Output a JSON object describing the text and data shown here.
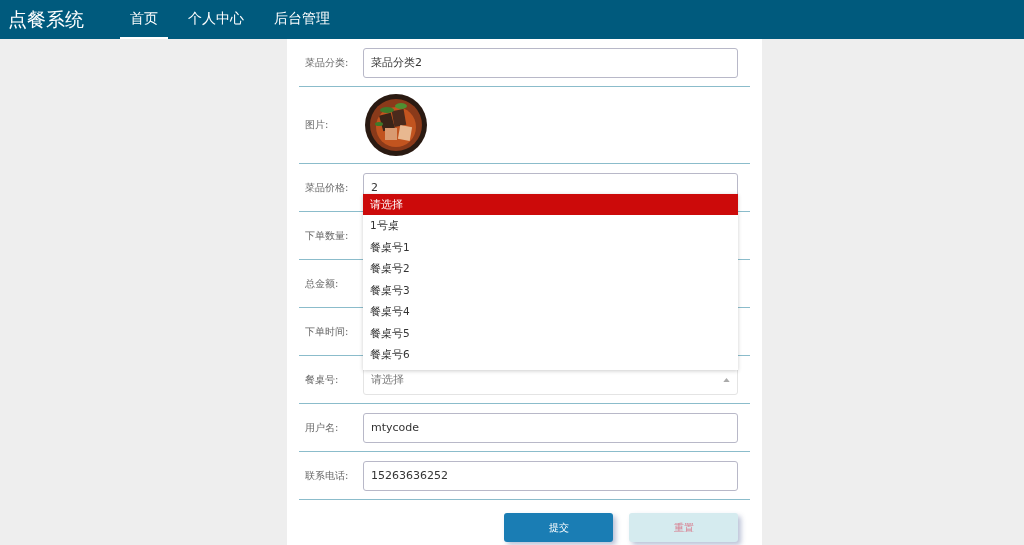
{
  "app_title": "点餐系统",
  "nav": [
    {
      "label": "首页",
      "selected": true
    },
    {
      "label": "个人中心",
      "selected": false
    },
    {
      "label": "后台管理",
      "selected": false
    }
  ],
  "fields": [
    {
      "label": "菜品分类:",
      "kind": "input",
      "value": "菜品分类2"
    },
    {
      "label": "图片:",
      "kind": "picture"
    },
    {
      "label": "菜品价格:",
      "kind": "input",
      "value": "2"
    },
    {
      "label": "下单数量:",
      "kind": "covered"
    },
    {
      "label": "总金额:",
      "kind": "covered"
    },
    {
      "label": "下单时间:",
      "kind": "covered"
    },
    {
      "label": "餐桌号:",
      "kind": "select",
      "placeholder": "请选择",
      "expanded": true,
      "options": [
        {
          "label": "请选择",
          "selected": true
        },
        {
          "label": "1号桌",
          "selected": false
        },
        {
          "label": "餐桌号1",
          "selected": false
        },
        {
          "label": "餐桌号2",
          "selected": false
        },
        {
          "label": "餐桌号3",
          "selected": false
        },
        {
          "label": "餐桌号4",
          "selected": false
        },
        {
          "label": "餐桌号5",
          "selected": false
        },
        {
          "label": "餐桌号6",
          "selected": false
        }
      ]
    },
    {
      "label": "用户名:",
      "kind": "input",
      "value": "mtycode"
    },
    {
      "label": "联系电话:",
      "kind": "input",
      "value": "15263636252"
    }
  ],
  "buttons": [
    {
      "label": "提交",
      "kind": "primary"
    },
    {
      "label": "重置",
      "kind": "secondary"
    }
  ]
}
